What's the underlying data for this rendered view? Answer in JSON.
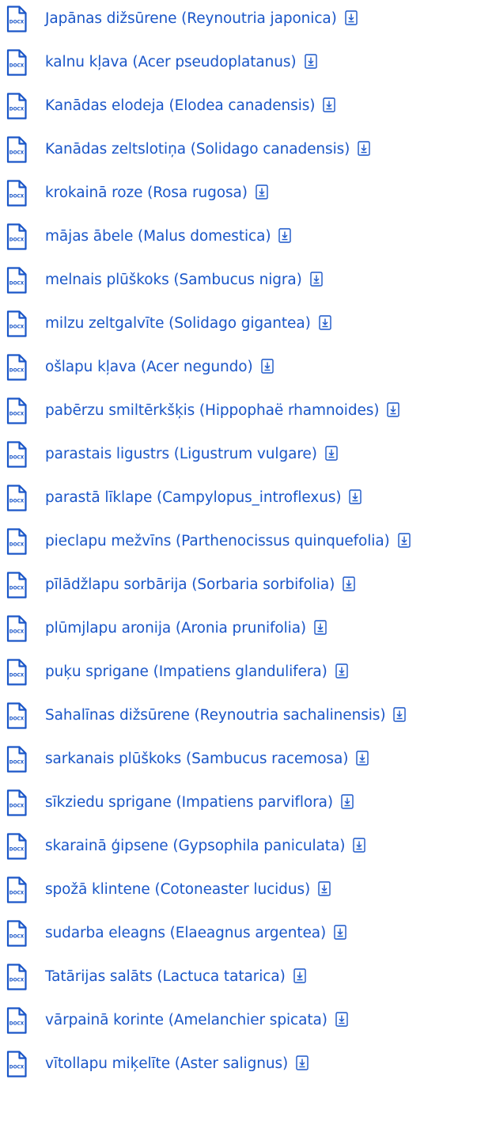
{
  "file_badge": "DOCX",
  "colors": {
    "link": "#1a56c8",
    "icon": "#1a56c8",
    "background": "#ffffff"
  },
  "icons": {
    "file": "docx-file-icon",
    "download": "download-icon"
  },
  "documents": [
    {
      "label": "Japānas dižsūrene (Reynoutria japonica)"
    },
    {
      "label": "kalnu kļava (Acer pseudoplatanus)"
    },
    {
      "label": "Kanādas elodeja (Elodea canadensis)"
    },
    {
      "label": "Kanādas zeltslotiņa (Solidago canadensis)"
    },
    {
      "label": "krokainā roze (Rosa rugosa)"
    },
    {
      "label": "mājas ābele (Malus domestica)"
    },
    {
      "label": "melnais plūškoks (Sambucus nigra)"
    },
    {
      "label": "milzu zeltgalvīte (Solidago gigantea)"
    },
    {
      "label": "ošlapu kļava (Acer negundo)"
    },
    {
      "label": "pabērzu smiltērkšķis (Hippophaë rhamnoides)"
    },
    {
      "label": "parastais ligustrs (Ligustrum vulgare)"
    },
    {
      "label": "parastā līklape (Campylopus_introflexus)"
    },
    {
      "label": "pieclapu mežvīns (Parthenocissus quinquefolia)"
    },
    {
      "label": "pīlādžlapu sorbārija (Sorbaria sorbifolia)"
    },
    {
      "label": "plūmjlapu aronija (Aronia prunifolia)"
    },
    {
      "label": "puķu sprigane (Impatiens glandulifera)"
    },
    {
      "label": "Sahalīnas dižsūrene (Reynoutria sachalinensis)"
    },
    {
      "label": "sarkanais plūškoks (Sambucus racemosa)"
    },
    {
      "label": "sīkziedu sprigane (Impatiens parviflora)"
    },
    {
      "label": "skarainā ģipsene (Gypsophila paniculata)"
    },
    {
      "label": "spožā klintene (Cotoneaster lucidus)"
    },
    {
      "label": "sudarba eleagns (Elaeagnus argentea)"
    },
    {
      "label": "Tatārijas salāts (Lactuca tatarica)"
    },
    {
      "label": "vārpainā korinte (Amelanchier spicata)"
    },
    {
      "label": "vītollapu miķelīte (Aster salignus)"
    }
  ]
}
